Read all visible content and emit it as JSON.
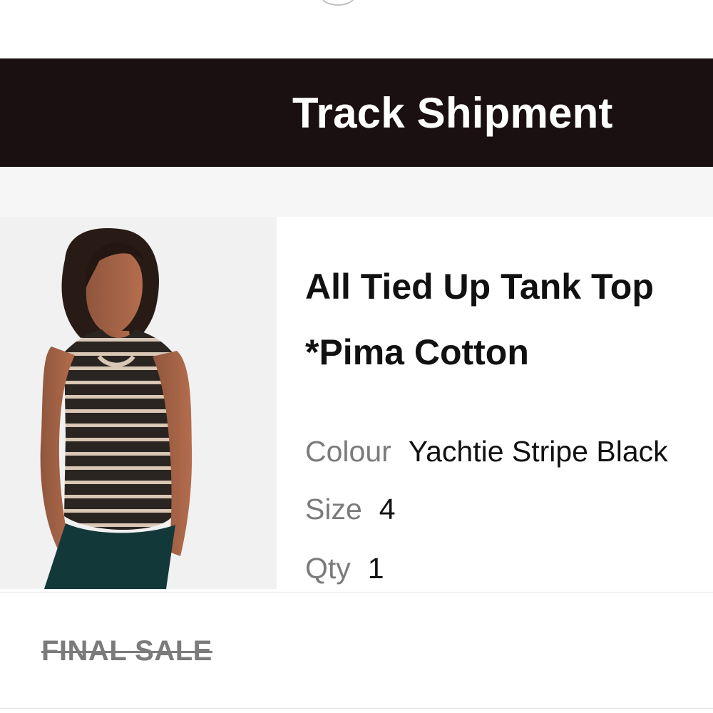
{
  "track_shipment": {
    "label": "Track Shipment"
  },
  "product": {
    "image_icon": "product-photo",
    "title": "All Tied Up Tank Top\n*Pima Cotton",
    "colour": {
      "label": "Colour",
      "value": "Yachtie Stripe Black"
    },
    "size": {
      "label": "Size",
      "value": "4"
    },
    "qty": {
      "label": "Qty",
      "value": "1"
    }
  },
  "final_sale": {
    "label": "FINAL SALE"
  }
}
